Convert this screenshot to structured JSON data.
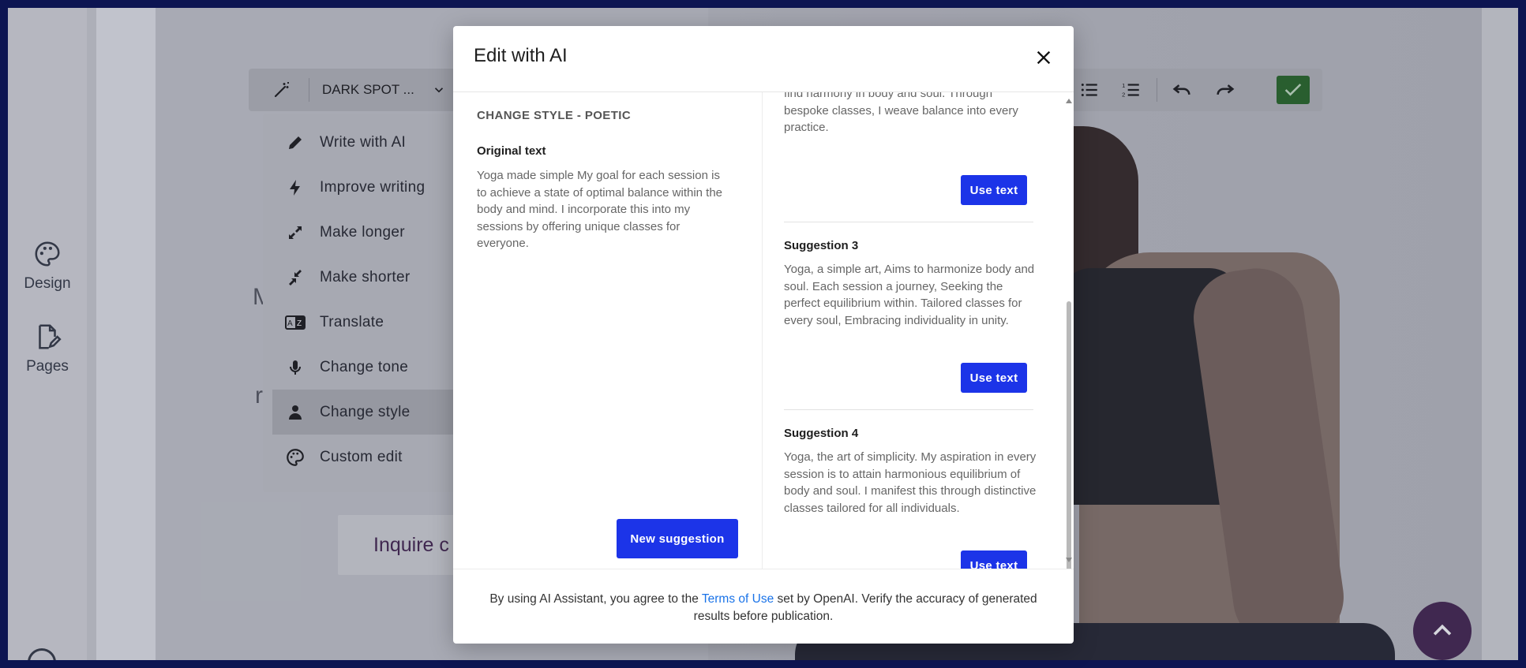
{
  "sidebar": {
    "items": [
      {
        "label": "Design",
        "icon": "palette-icon"
      },
      {
        "label": "Pages",
        "icon": "page-edit-icon"
      }
    ]
  },
  "toolbar": {
    "magic_icon": "magic-wand-icon",
    "style_select": "DARK SPOT ...",
    "check_color": "#2e6d2d"
  },
  "ai_menu": {
    "items": [
      {
        "label": "Write with AI",
        "icon": "pencil-icon"
      },
      {
        "label": "Improve writing",
        "icon": "bolt-icon"
      },
      {
        "label": "Make longer",
        "icon": "expand-icon"
      },
      {
        "label": "Make shorter",
        "icon": "collapse-icon"
      },
      {
        "label": "Translate",
        "icon": "translate-icon"
      },
      {
        "label": "Change tone",
        "icon": "microphone-icon"
      },
      {
        "label": "Change style",
        "icon": "person-icon",
        "active": true
      },
      {
        "label": "Custom edit",
        "icon": "palette-icon"
      }
    ]
  },
  "background": {
    "text_m": "M",
    "text_r": "r",
    "inquire_label": "Inquire c"
  },
  "modal": {
    "title": "Edit with AI",
    "style_heading": "CHANGE STYLE - POETIC",
    "original_label": "Original text",
    "original_text": "Yoga made simple My goal for each session is to achieve a state of optimal balance within the body and mind. I incorporate this into my sessions by offering unique classes for everyone.",
    "new_suggestion_label": "New suggestion",
    "partial_suggestion": "find harmony in body and soul. Through bespoke classes, I weave balance into every practice.",
    "use_text_label": "Use text",
    "suggestions": [
      {
        "title": "Suggestion 3",
        "text": "Yoga, a simple art, Aims to harmonize body and soul. Each session a journey, Seeking the perfect equilibrium within. Tailored classes for every soul, Embracing individuality in unity."
      },
      {
        "title": "Suggestion 4",
        "text": "Yoga, the art of simplicity. My aspiration in every session is to attain harmonious equilibrium of body and soul. I manifest this through distinctive classes tailored for all individuals."
      }
    ],
    "footer_before": "By using AI Assistant, you agree to the ",
    "footer_link": "Terms of Use",
    "footer_after": " set by OpenAI. Verify the accuracy of generated results before publication.",
    "accent_color": "#1c34e8"
  }
}
